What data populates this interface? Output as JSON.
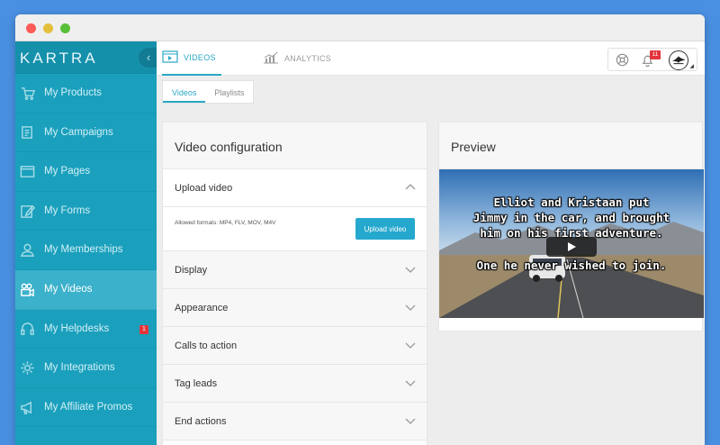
{
  "brand": {
    "logo": "KARTRA",
    "collapse": "‹"
  },
  "sidebar": {
    "items": [
      {
        "label": "My Products",
        "icon": "cart-icon"
      },
      {
        "label": "My Campaigns",
        "icon": "campaigns-icon"
      },
      {
        "label": "My Pages",
        "icon": "pages-icon"
      },
      {
        "label": "My Forms",
        "icon": "forms-icon"
      },
      {
        "label": "My Memberships",
        "icon": "memberships-icon"
      },
      {
        "label": "My Videos",
        "icon": "video-camera-icon",
        "active": true
      },
      {
        "label": "My Helpdesks",
        "icon": "headset-icon",
        "badge": "1"
      },
      {
        "label": "My Integrations",
        "icon": "integrations-icon"
      },
      {
        "label": "My Affiliate Promos",
        "icon": "megaphone-icon"
      }
    ]
  },
  "topbar": {
    "tabs": [
      {
        "label": "VIDEOS",
        "icon": "video-player-icon",
        "active": true
      },
      {
        "label": "ANALYTICS",
        "icon": "analytics-chart-icon"
      }
    ],
    "notification_count": "11"
  },
  "subtabs": [
    {
      "label": "Videos",
      "active": true
    },
    {
      "label": "Playlists"
    }
  ],
  "config": {
    "title": "Video configuration",
    "upload": {
      "label": "Upload video",
      "formats": "Allowed formats: MP4, FLV, MOV, M4V",
      "button": "Upload video"
    },
    "sections": [
      "Display",
      "Appearance",
      "Calls to action",
      "Tag leads",
      "End actions"
    ]
  },
  "preview": {
    "title": "Preview",
    "subtitle_lines": [
      "Elliot and Kristaan put",
      "Jimmy in the car, and brought",
      "him on his first adventure."
    ],
    "subtitle_last": "One he never wished to join."
  },
  "colors": {
    "accent": "#2aa7c5",
    "sidebar": "#1aa0bd",
    "badge": "#e3353c",
    "page_bg": "#4a90e2"
  }
}
